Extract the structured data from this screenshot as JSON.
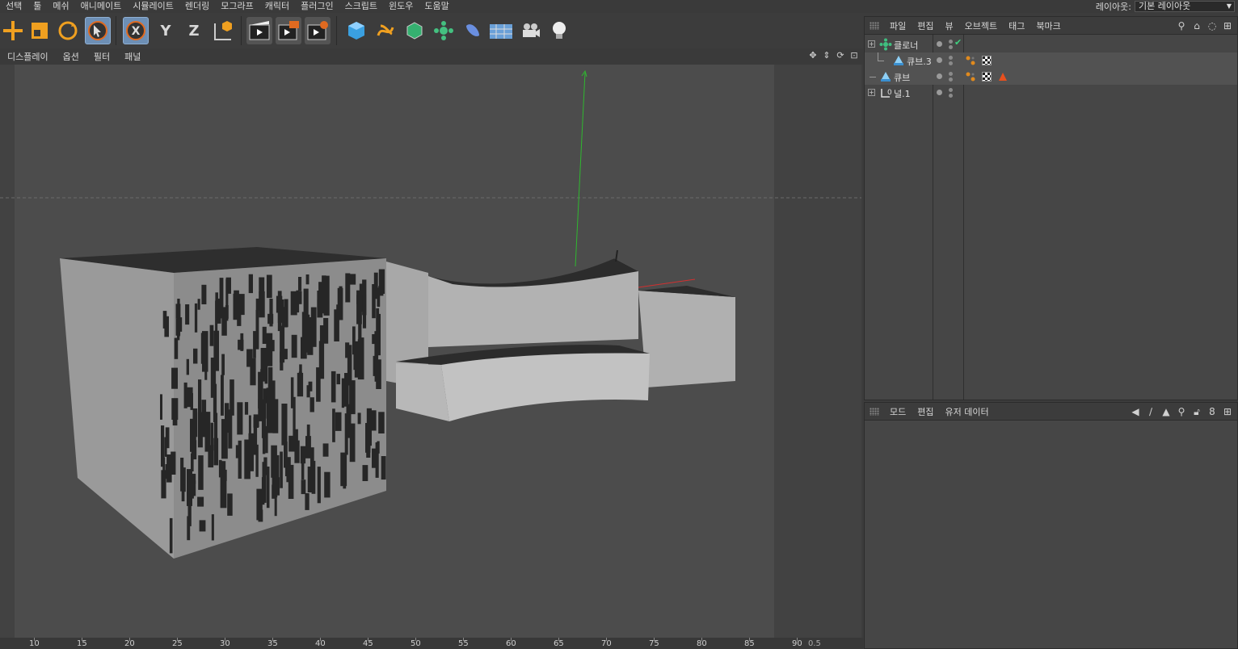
{
  "menubar": {
    "items": [
      "선택",
      "툴",
      "메쉬",
      "애니메이트",
      "시뮬레이트",
      "렌더링",
      "모그라프",
      "캐릭터",
      "플러그인",
      "스크립트",
      "윈도우",
      "도움말"
    ],
    "layout_label": "레이아웃:",
    "layout_value": "기본 레이아웃"
  },
  "toolbar": {
    "buttons": [
      {
        "name": "move-icon"
      },
      {
        "name": "scale-icon"
      },
      {
        "name": "rotate-icon"
      },
      {
        "name": "live-selection-icon",
        "selected": true
      },
      {
        "name": "x-axis-icon",
        "label": "X",
        "selected": true
      },
      {
        "name": "y-axis-icon",
        "label": "Y"
      },
      {
        "name": "z-axis-icon",
        "label": "Z"
      },
      {
        "name": "coordinate-system-icon"
      },
      {
        "name": "render-view-icon"
      },
      {
        "name": "render-picture-viewer-icon"
      },
      {
        "name": "render-settings-icon"
      },
      {
        "name": "cube-primitive-icon"
      },
      {
        "name": "spline-pen-icon"
      },
      {
        "name": "subdivision-surface-icon"
      },
      {
        "name": "cloner-icon"
      },
      {
        "name": "deformer-icon"
      },
      {
        "name": "floor-scene-icon"
      },
      {
        "name": "camera-icon"
      },
      {
        "name": "light-icon"
      }
    ]
  },
  "viewport_menu": {
    "items": [
      "디스플레이",
      "옵션",
      "필터",
      "패널"
    ]
  },
  "timeline": {
    "ticks": [
      "10",
      "15",
      "20",
      "25",
      "30",
      "35",
      "40",
      "45",
      "50",
      "55",
      "60",
      "65",
      "70",
      "75",
      "80",
      "85",
      "90"
    ],
    "field_value": "0.5"
  },
  "object_manager": {
    "menu": [
      "파일",
      "편집",
      "뷰",
      "오브젝트",
      "태그",
      "북마크"
    ],
    "objects": [
      {
        "name": "클로너",
        "indent": 0,
        "icon": "cloner-object-icon",
        "expandable": true,
        "check": "✔"
      },
      {
        "name": "큐브.3",
        "indent": 1,
        "icon": "cube-object-icon",
        "tags": [
          "phong-tag",
          "texture-tag"
        ]
      },
      {
        "name": "큐브",
        "indent": 0,
        "icon": "cube-object-icon",
        "tags": [
          "phong-tag",
          "texture-tag",
          "warning-tag"
        ]
      },
      {
        "name": "널.1",
        "indent": 0,
        "icon": "null-object-icon",
        "expandable": true
      }
    ]
  },
  "attribute_manager": {
    "menu": [
      "모드",
      "편집",
      "유저 데이터"
    ]
  },
  "colors": {
    "accent": "#6d8fb5",
    "axis_y": "#2fb82f",
    "axis_x": "#d23030",
    "orange": "#e08a1e"
  }
}
